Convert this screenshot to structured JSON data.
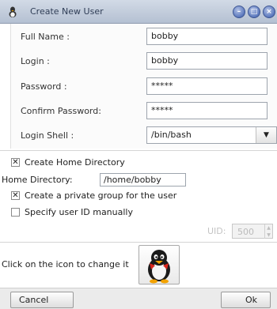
{
  "window": {
    "title": "Create New User",
    "controls": [
      "minimize-icon",
      "maximize-icon",
      "close-icon"
    ]
  },
  "form": {
    "full_name_label": "Full Name :",
    "full_name_value": "bobby",
    "login_label": "Login :",
    "login_value": "bobby",
    "password_label": "Password :",
    "password_value": "*****",
    "confirm_label": "Confirm Password:",
    "confirm_value": "*****",
    "shell_label": "Login Shell :",
    "shell_value": "/bin/bash"
  },
  "options": {
    "create_home_label": "Create Home Directory",
    "create_home_checked": true,
    "home_dir_label": "Home Directory:",
    "home_dir_value": "/home/bobby",
    "private_group_label": "Create a private group for the user",
    "private_group_checked": true,
    "manual_uid_label": "Specify user ID manually",
    "manual_uid_checked": false,
    "uid_label": "UID:",
    "uid_value": "500"
  },
  "icon": {
    "hint": "Click on the icon to change it",
    "avatar": "tux-penguin-icon"
  },
  "buttons": {
    "cancel": "Cancel",
    "ok": "Ok"
  },
  "colors": {
    "titlebar": "#b4c0d2",
    "window_buttons": "#5b78bd"
  }
}
